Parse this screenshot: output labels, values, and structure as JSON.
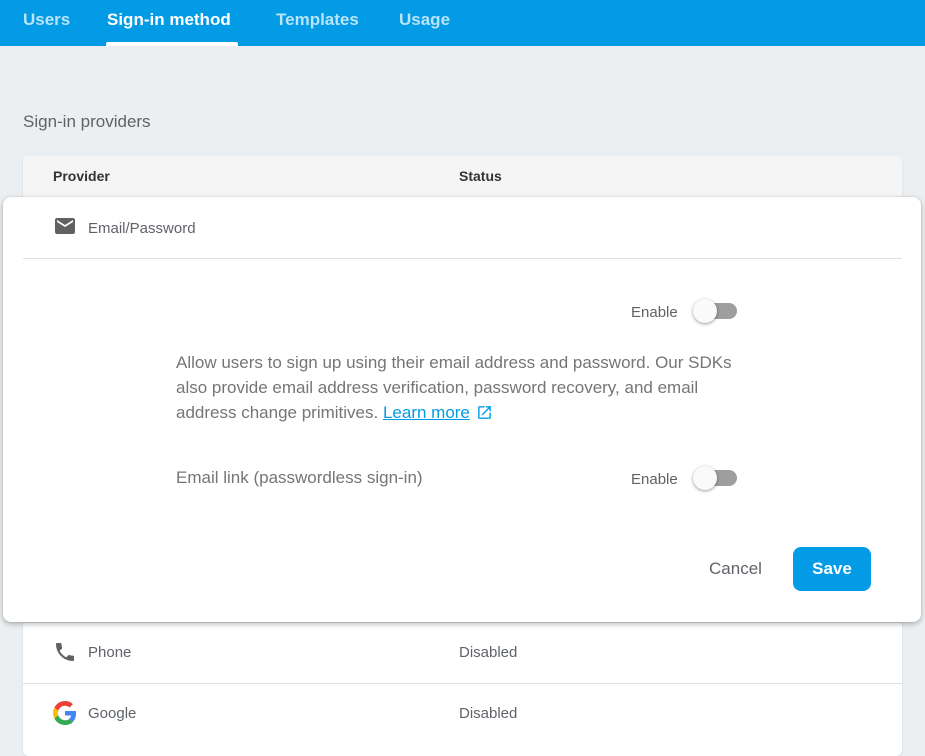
{
  "tabs": [
    {
      "label": "Users"
    },
    {
      "label": "Sign-in method"
    },
    {
      "label": "Templates"
    },
    {
      "label": "Usage"
    }
  ],
  "section_title": "Sign-in providers",
  "table": {
    "columns": [
      "Provider",
      "Status"
    ],
    "rows": [
      {
        "provider": "Phone",
        "status": "Disabled",
        "icon": "phone-icon"
      },
      {
        "provider": "Google",
        "status": "Disabled",
        "icon": "google-logo-icon"
      }
    ]
  },
  "panel": {
    "provider_label": "Email/Password",
    "provider_icon": "mail-icon",
    "enable_label": "Enable",
    "description": "Allow users to sign up using their email address and password. Our SDKs also provide email address verification, password recovery, and email address change primitives.",
    "learn_more": "Learn more",
    "email_link_label": "Email link (passwordless sign-in)",
    "email_link_enable_label": "Enable",
    "email_password_enabled": false,
    "email_link_enabled": false,
    "cancel_label": "Cancel",
    "save_label": "Save"
  },
  "colors": {
    "accent": "#039be5",
    "background": "#eceff1",
    "toggle_off": "#9e9e9e"
  }
}
